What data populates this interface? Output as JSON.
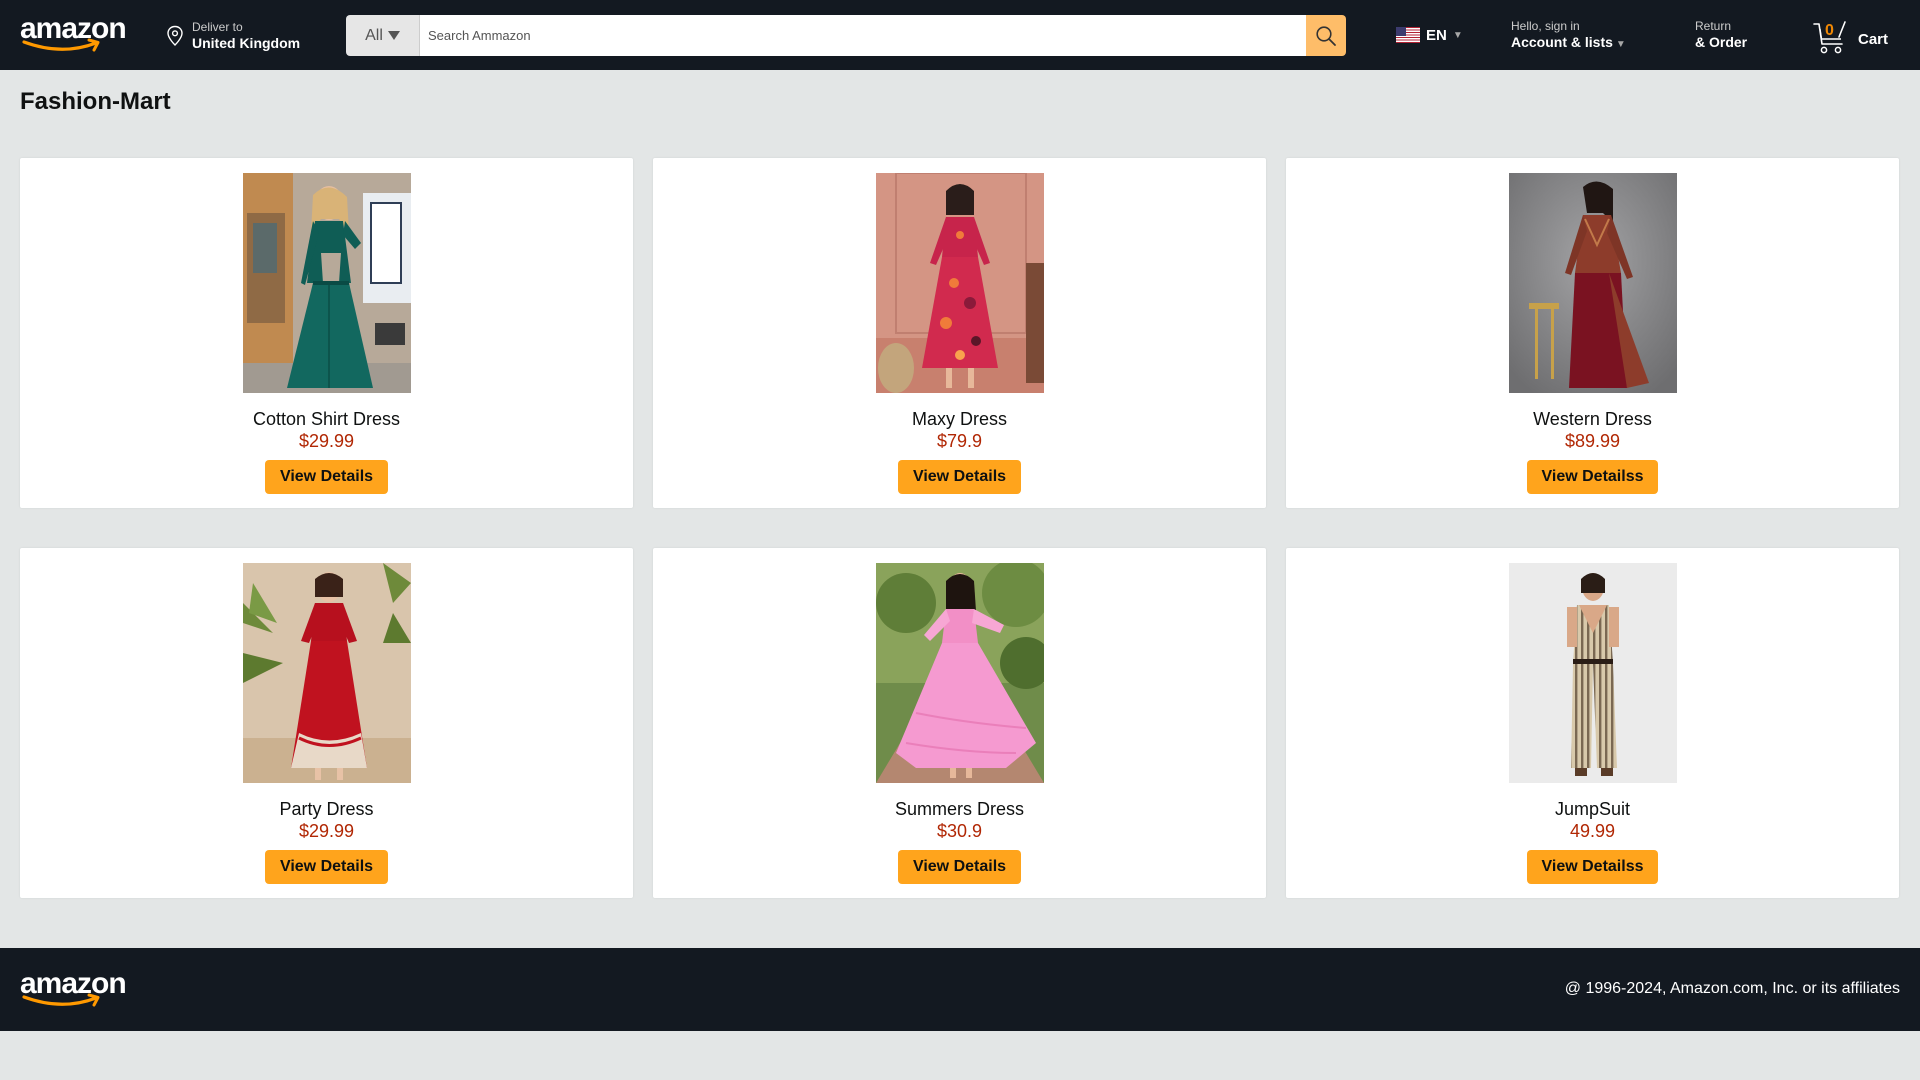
{
  "header": {
    "logo_text": "amazon",
    "deliver_small": "Deliver to",
    "deliver_bold": "United Kingdom",
    "search_category": "All",
    "search_placeholder": "Search Ammazon",
    "language": "EN",
    "account_small": "Hello, sign in",
    "account_bold": "Account & lists",
    "returns_small": "Return",
    "returns_bold": "& Order",
    "cart_count": "0",
    "cart_label": "Cart"
  },
  "page": {
    "title": "Fashion-Mart"
  },
  "products": [
    {
      "name": "Cotton Shirt Dress",
      "price": "$29.99",
      "button": "View Details",
      "image": "green-shirt-dress"
    },
    {
      "name": "Maxy Dress",
      "price": "$79.9",
      "button": "View Details",
      "image": "floral-maxi-dress"
    },
    {
      "name": "Western Dress",
      "price": "$89.99",
      "button": "View Detailss",
      "image": "maroon-western-dress"
    },
    {
      "name": "Party Dress",
      "price": "$29.99",
      "button": "View Details",
      "image": "red-party-dress"
    },
    {
      "name": "Summers Dress",
      "price": "$30.9",
      "button": "View Details",
      "image": "pink-summer-dress"
    },
    {
      "name": "JumpSuit",
      "price": "49.99",
      "button": "View Detailss",
      "image": "striped-jumpsuit"
    }
  ],
  "footer": {
    "logo_text": "amazon",
    "copyright": "@ 1996-2024, Amazon.com, Inc. or its affiliates"
  },
  "colors": {
    "header_bg": "#131921",
    "search_button": "#febd69",
    "view_button": "#ffa41c",
    "price": "#b12704",
    "page_bg": "#e3e6e6"
  }
}
